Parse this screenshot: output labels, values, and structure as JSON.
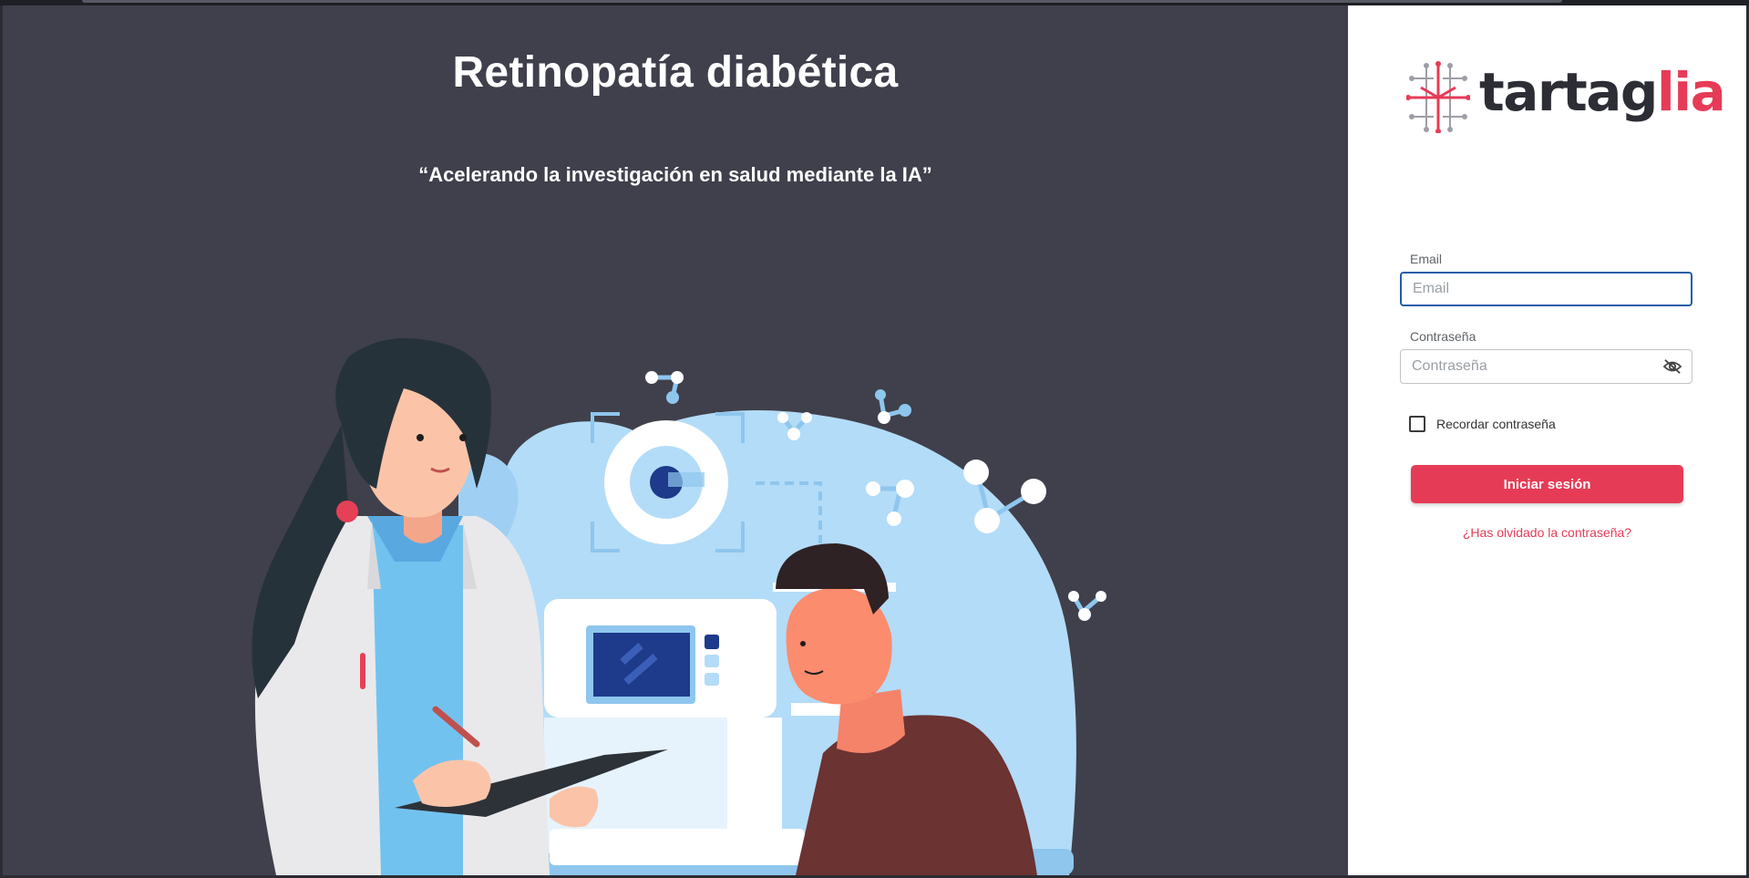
{
  "hero": {
    "title": "Retinopatía diabética",
    "quote": "“Acelerando la investigación en salud mediante la IA”"
  },
  "brand": {
    "name_main": "tartag",
    "name_accent": "lia",
    "primary_color": "#e63b57",
    "dark_color": "#2d2d35"
  },
  "login": {
    "email_label": "Email",
    "email_placeholder": "Email",
    "email_value": "",
    "password_label": "Contraseña",
    "password_placeholder": "Contraseña",
    "password_value": "",
    "toggle_visibility_icon": "eye-off-icon",
    "remember_label": "Recordar contraseña",
    "remember_checked": false,
    "submit_label": "Iniciar sesión",
    "forgot_label": "¿Has olvidado la contraseña?"
  },
  "illustration": {
    "subject": "doctor-and-patient-eye-exam"
  }
}
